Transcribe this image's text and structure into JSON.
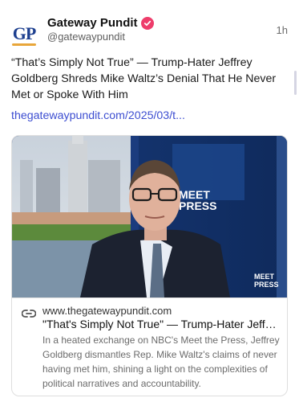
{
  "post": {
    "author": "Gateway Pundit",
    "handle": "@gatewaypundit",
    "time": "1h",
    "avatar_text": "GP",
    "text": "“That’s Simply Not True” — Trump-Hater Jeffrey Goldberg Shreds Mike Waltz’s Denial That He Never Met or Spoke With Him",
    "link": "thegatewaypundit.com/2025/03/t..."
  },
  "card": {
    "domain": "www.thegatewaypundit.com",
    "title": "\"That's Simply Not True\" — Trump-Hater Jeffre...",
    "description": "In a heated exchange on NBC's Meet the Press, Jeffrey Goldberg dismantles Rep. Mike Waltz's claims of never having met him, shining a light on the complexities of political narratives and accountability.",
    "image_logo": "MEET\nTHE\nPRESS",
    "image_logo_main": "MEET THE PRESS",
    "image_logo_small": "MEET THE PRESS"
  },
  "colors": {
    "verified": "#ee3d6b",
    "link": "#3d4ed1",
    "brand_blue": "#1d3f8f"
  },
  "icons": {
    "verified": "verified-badge-icon",
    "link": "link-icon"
  }
}
